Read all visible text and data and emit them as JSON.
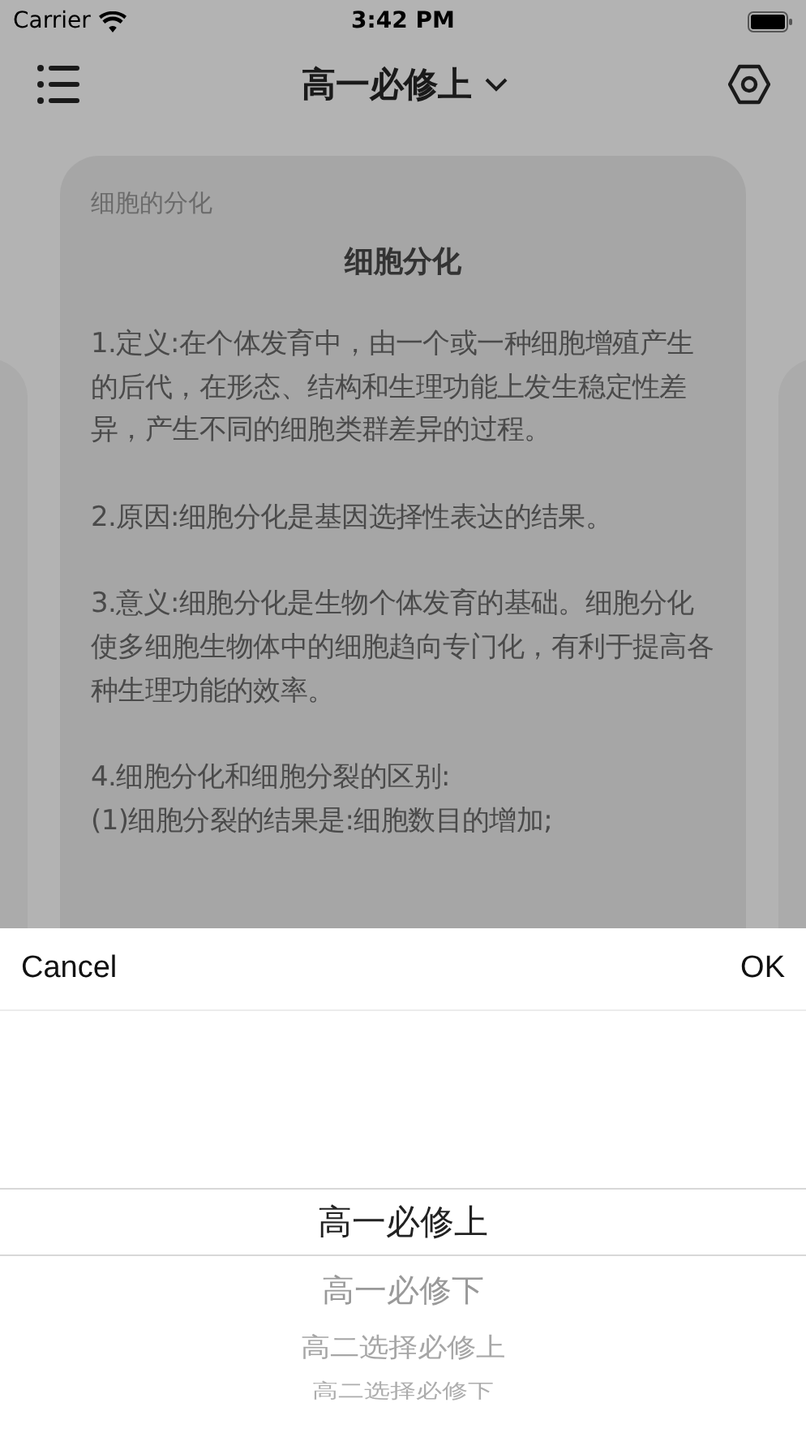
{
  "status_bar": {
    "carrier": "Carrier",
    "time": "3:42 PM"
  },
  "nav": {
    "title": "高一必修上"
  },
  "card": {
    "section": "细胞的分化",
    "title": "细胞分化",
    "paragraphs": [
      "1.定义:在个体发育中，由一个或一种细胞增殖产生的后代，在形态、结构和生理功能上发生稳定性差异，产生不同的细胞类群差异的过程。",
      "2.原因:细胞分化是基因选择性表达的结果。",
      "3.意义:细胞分化是生物个体发育的基础。细胞分化使多细胞生物体中的细胞趋向专门化，有利于提高各种生理功能的效率。",
      "4.细胞分化和细胞分裂的区别:\n(1)细胞分裂的结果是:细胞数目的增加;"
    ]
  },
  "picker": {
    "cancel": "Cancel",
    "ok": "OK",
    "options": [
      {
        "label": "高一必修上",
        "selected": true
      },
      {
        "label": "高一必修下",
        "selected": false
      },
      {
        "label": "高二选择必修上",
        "selected": false
      },
      {
        "label": "高二选择必修下",
        "selected": false
      }
    ]
  }
}
